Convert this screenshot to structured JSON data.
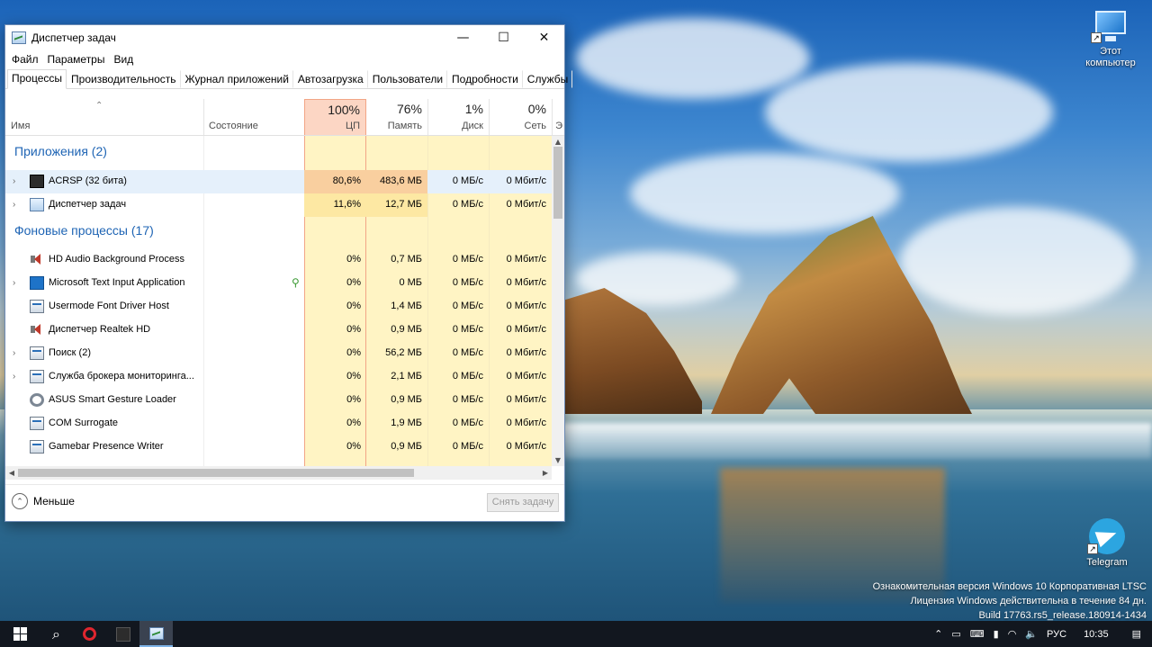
{
  "desktop": {
    "icons": [
      {
        "label": "Этот\nкомпьютер"
      },
      {
        "label": "Telegram"
      }
    ],
    "watermark": [
      "Ознакомительная версия Windows 10 Корпоративная LTSC",
      "Лицензия Windows действительна в течение 84 дн.",
      "Build 17763.rs5_release.180914-1434"
    ]
  },
  "window": {
    "title": "Диспетчер задач",
    "controls": {
      "minimize": "—",
      "maximize": "☐",
      "close": "✕"
    },
    "menu": [
      "Файл",
      "Параметры",
      "Вид"
    ],
    "tabs": [
      "Процессы",
      "Производительность",
      "Журнал приложений",
      "Автозагрузка",
      "Пользователи",
      "Подробности",
      "Службы"
    ],
    "active_tab": 0,
    "columns": {
      "name": "Имя",
      "status": "Состояние",
      "cpu": {
        "pct": "100%",
        "label": "ЦП"
      },
      "memory": {
        "pct": "76%",
        "label": "Память"
      },
      "disk": {
        "pct": "1%",
        "label": "Диск"
      },
      "network": {
        "pct": "0%",
        "label": "Сеть"
      },
      "cut": "Э"
    },
    "groups": {
      "apps": "Приложения (2)",
      "background": "Фоновые процессы (17)"
    },
    "apps": [
      {
        "name": "ACRSP (32 бита)",
        "cpu": "80,6%",
        "mem": "483,6 МБ",
        "disk": "0 МБ/с",
        "net": "0 Мбит/с",
        "expandable": true,
        "icon": "app-icon",
        "selected": true
      },
      {
        "name": "Диспетчер задач",
        "cpu": "11,6%",
        "mem": "12,7 МБ",
        "disk": "0 МБ/с",
        "net": "0 Мбит/с",
        "expandable": true,
        "icon": "task-manager-icon"
      }
    ],
    "background": [
      {
        "name": "HD Audio Background Process",
        "cpu": "0%",
        "mem": "0,7 МБ",
        "disk": "0 МБ/с",
        "net": "0 Мбит/с",
        "expandable": false,
        "icon": "speaker-icon"
      },
      {
        "name": "Microsoft Text Input Application",
        "cpu": "0%",
        "mem": "0 МБ",
        "disk": "0 МБ/с",
        "net": "0 Мбит/с",
        "expandable": true,
        "icon": "text-input-icon",
        "suspended": true
      },
      {
        "name": "Usermode Font Driver Host",
        "cpu": "0%",
        "mem": "1,4 МБ",
        "disk": "0 МБ/с",
        "net": "0 Мбит/с",
        "expandable": false,
        "icon": "window-icon"
      },
      {
        "name": "Диспетчер Realtek HD",
        "cpu": "0%",
        "mem": "0,9 МБ",
        "disk": "0 МБ/с",
        "net": "0 Мбит/с",
        "expandable": false,
        "icon": "speaker-icon"
      },
      {
        "name": "Поиск (2)",
        "cpu": "0%",
        "mem": "56,2 МБ",
        "disk": "0 МБ/с",
        "net": "0 Мбит/с",
        "expandable": true,
        "icon": "window-icon"
      },
      {
        "name": "Служба брокера мониторинга...",
        "cpu": "0%",
        "mem": "2,1 МБ",
        "disk": "0 МБ/с",
        "net": "0 Мбит/с",
        "expandable": true,
        "icon": "window-icon"
      },
      {
        "name": "ASUS Smart Gesture Loader",
        "cpu": "0%",
        "mem": "0,9 МБ",
        "disk": "0 МБ/с",
        "net": "0 Мбит/с",
        "expandable": false,
        "icon": "gear-icon"
      },
      {
        "name": "COM Surrogate",
        "cpu": "0%",
        "mem": "1,9 МБ",
        "disk": "0 МБ/с",
        "net": "0 Мбит/с",
        "expandable": false,
        "icon": "window-icon"
      },
      {
        "name": "Gamebar Presence Writer",
        "cpu": "0%",
        "mem": "0,9 МБ",
        "disk": "0 МБ/с",
        "net": "0 Мбит/с",
        "expandable": false,
        "icon": "window-icon"
      }
    ],
    "footer": {
      "less": "Меньше",
      "end_task": "Снять задачу"
    }
  },
  "taskbar": {
    "language": "РУС",
    "time": "10:35"
  },
  "colors": {
    "cpu_heavy": "#f9cf9f",
    "cpu_medium": "#fde8a3",
    "cpu_light": "#fff4c4",
    "selected_row": "#e5f0fb",
    "group_text": "#1e64b4"
  }
}
